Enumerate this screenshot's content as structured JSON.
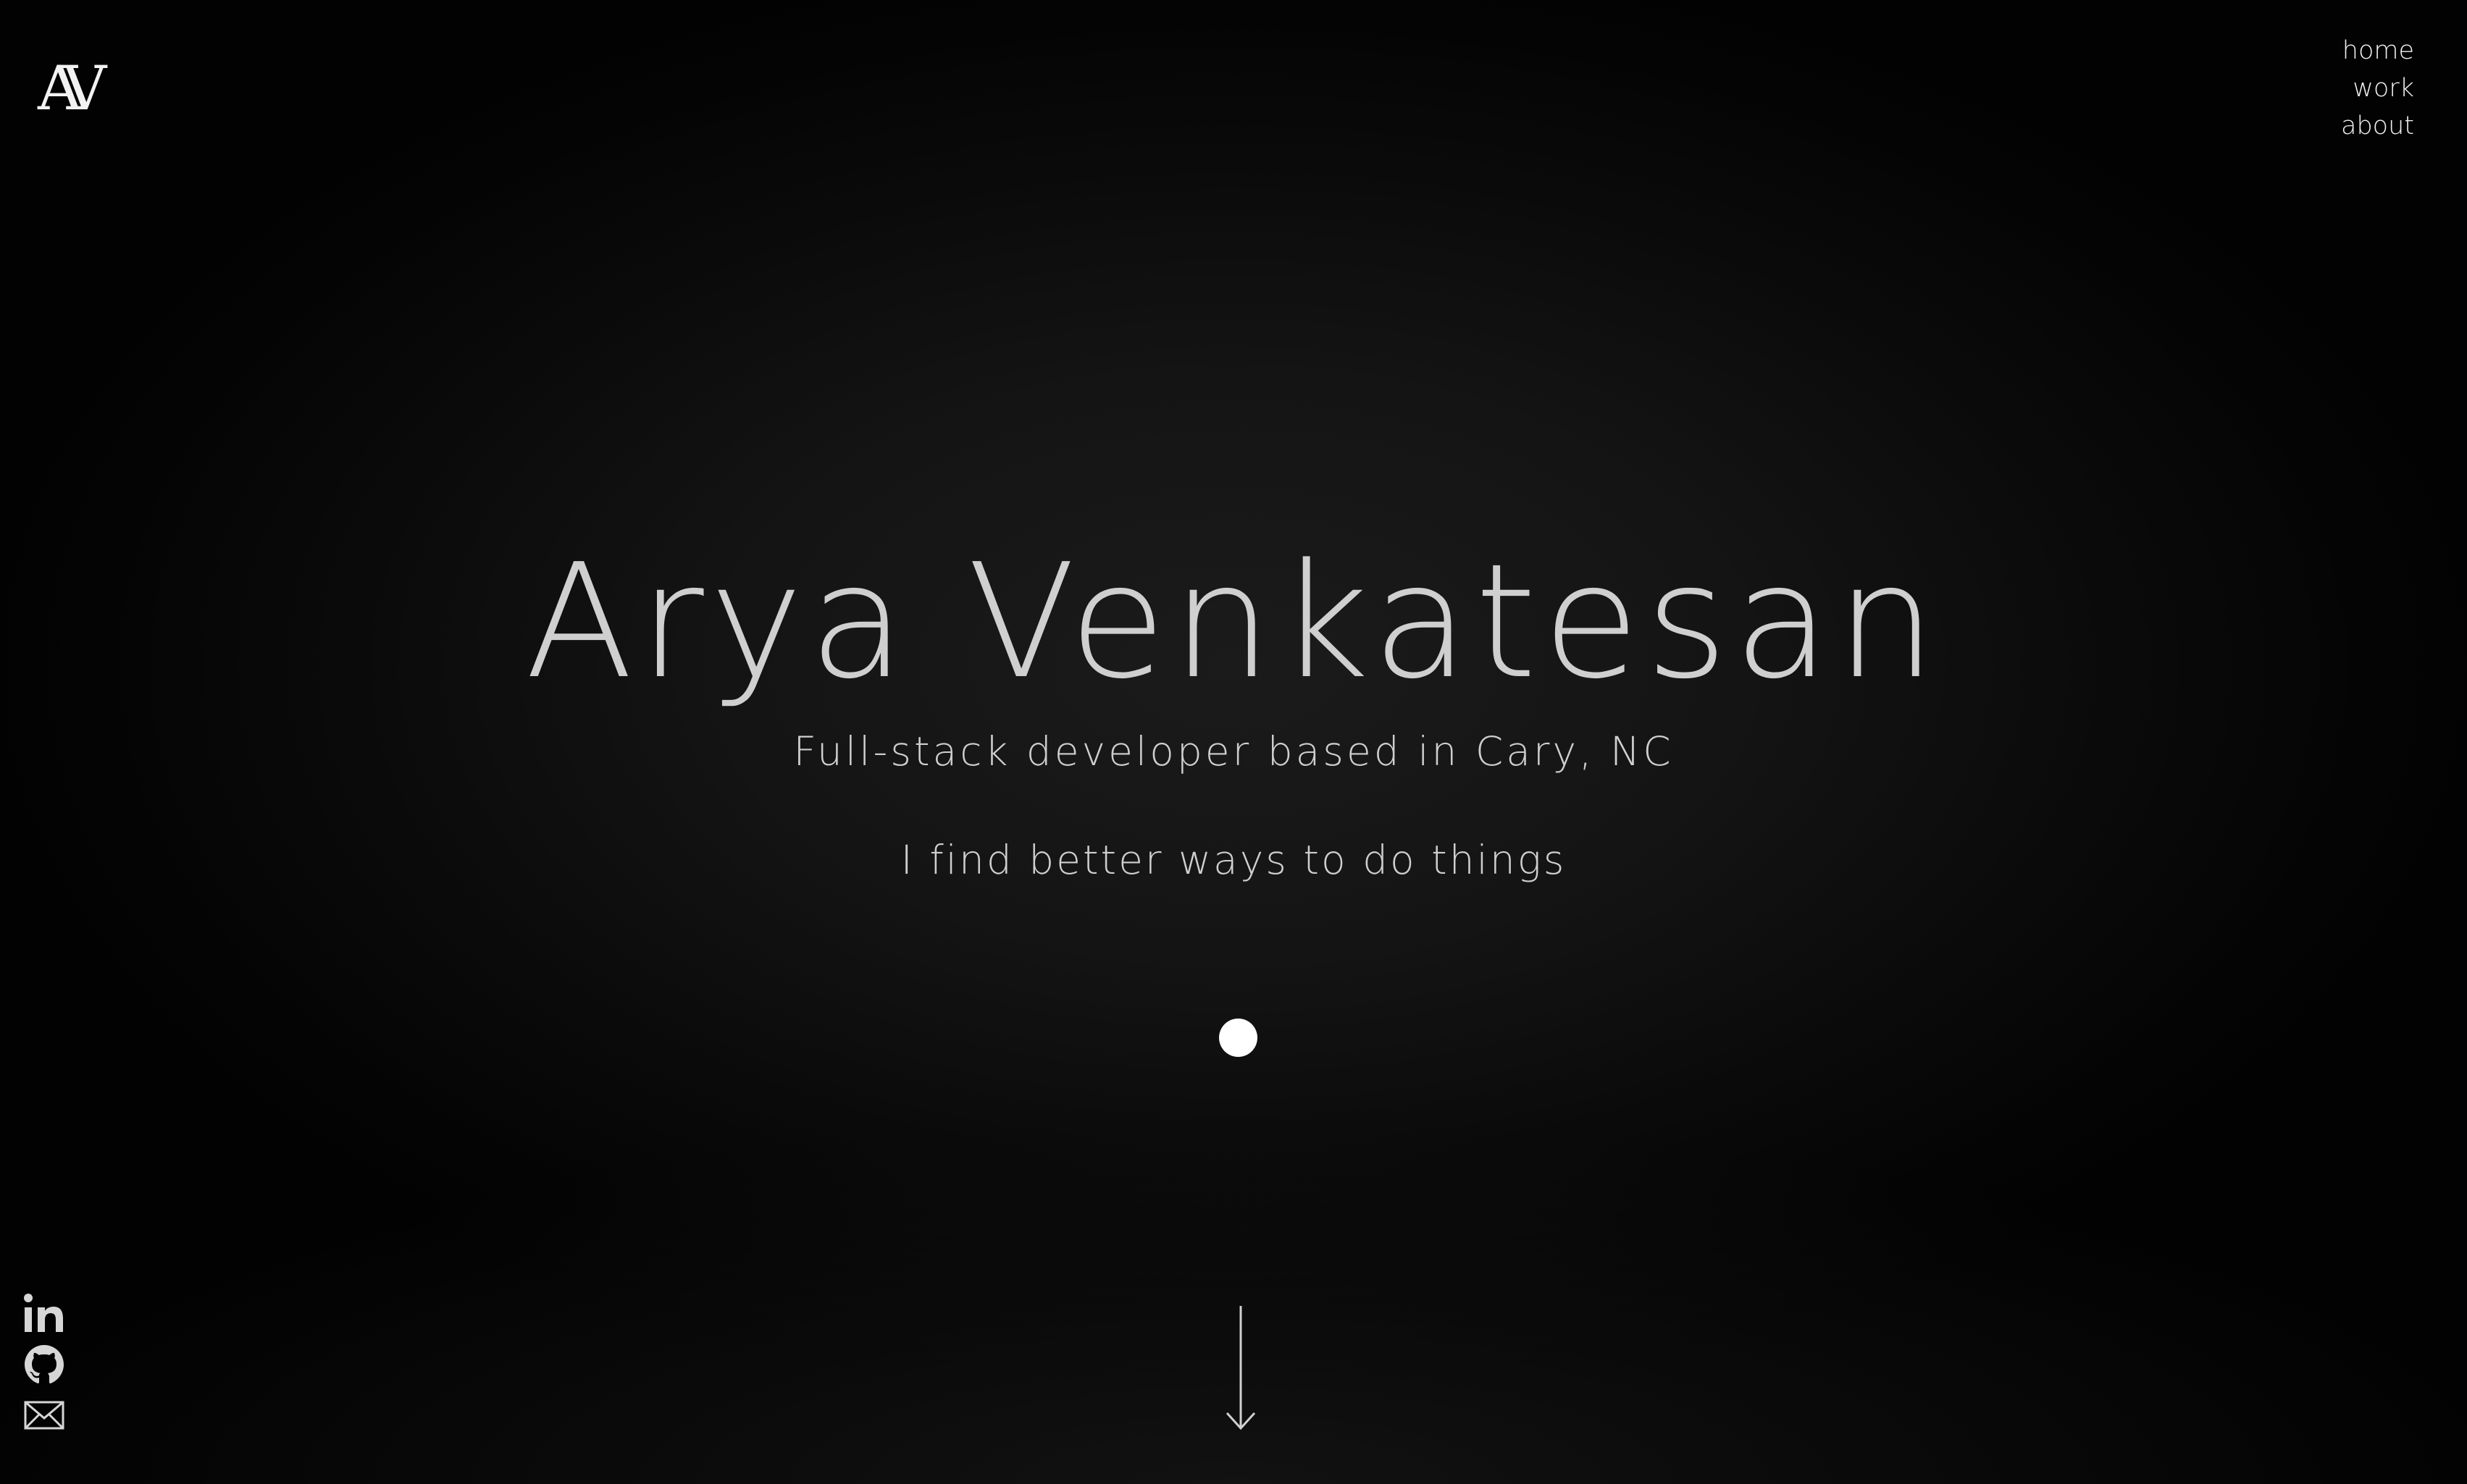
{
  "header": {
    "logo_text": "AV"
  },
  "nav": {
    "items": [
      {
        "label": "home"
      },
      {
        "label": "work"
      },
      {
        "label": "about"
      }
    ]
  },
  "hero": {
    "name": "Arya Venkatesan",
    "subtitle": "Full-stack developer based in Cary, NC",
    "tagline": "I find better ways to do things"
  },
  "social": {
    "icons": [
      "linkedin-icon",
      "github-icon",
      "mail-icon"
    ]
  },
  "colors": {
    "background": "#000000",
    "text": "#cfcfcf",
    "accent": "#ffffff"
  }
}
